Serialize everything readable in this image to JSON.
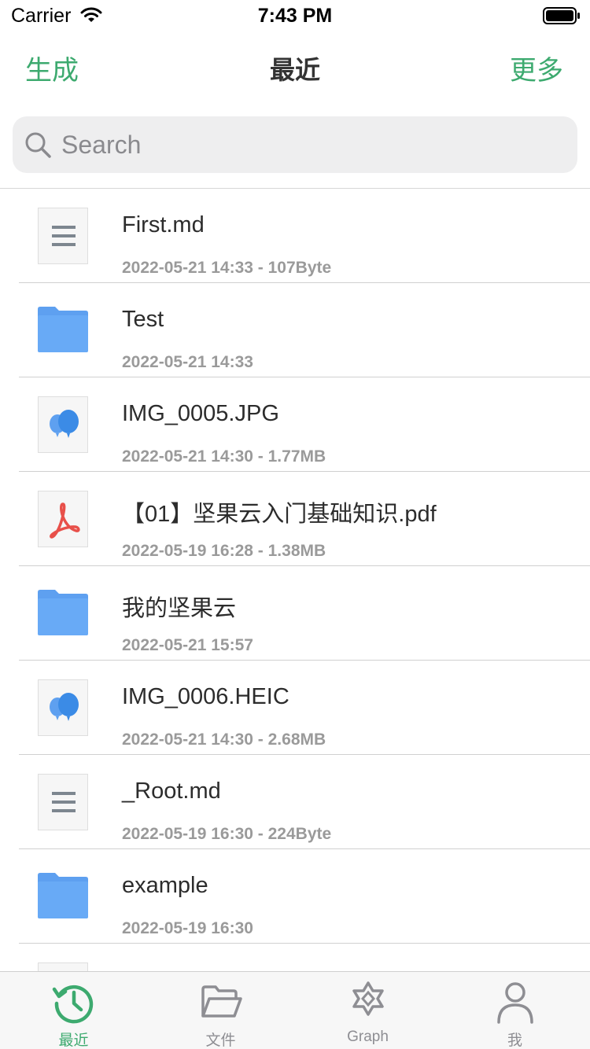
{
  "status_bar": {
    "carrier": "Carrier",
    "time": "7:43 PM"
  },
  "nav": {
    "left": "生成",
    "title": "最近",
    "right": "更多"
  },
  "search": {
    "placeholder": "Search",
    "value": ""
  },
  "files": [
    {
      "name": "First.md",
      "meta": "2022-05-21 14:33 - 107Byte",
      "icon": "markdown-file-icon"
    },
    {
      "name": "Test",
      "meta": "2022-05-21 14:33",
      "icon": "folder-icon"
    },
    {
      "name": "IMG_0005.JPG",
      "meta": "2022-05-21 14:30 - 1.77MB",
      "icon": "image-file-icon"
    },
    {
      "name": "【01】坚果云入门基础知识.pdf",
      "meta": "2022-05-19 16:28 - 1.38MB",
      "icon": "pdf-file-icon"
    },
    {
      "name": "我的坚果云",
      "meta": "2022-05-21 15:57",
      "icon": "folder-icon"
    },
    {
      "name": "IMG_0006.HEIC",
      "meta": "2022-05-21 14:30 - 2.68MB",
      "icon": "image-file-icon"
    },
    {
      "name": "_Root.md",
      "meta": "2022-05-19 16:30 - 224Byte",
      "icon": "markdown-file-icon"
    },
    {
      "name": "example",
      "meta": "2022-05-19 16:30",
      "icon": "folder-icon"
    },
    {
      "name": "",
      "meta": "",
      "icon": "markdown-file-icon"
    }
  ],
  "tabs": [
    {
      "label": "最近",
      "icon": "history-icon",
      "active": true
    },
    {
      "label": "文件",
      "icon": "folder-open-icon",
      "active": false
    },
    {
      "label": "Graph",
      "icon": "graph-icon",
      "active": false
    },
    {
      "label": "我",
      "icon": "person-icon",
      "active": false
    }
  ],
  "colors": {
    "accent": "#3daa6f",
    "folder": "#5ea0f0",
    "pdf": "#e8504a",
    "inactive": "#8e8e93"
  }
}
